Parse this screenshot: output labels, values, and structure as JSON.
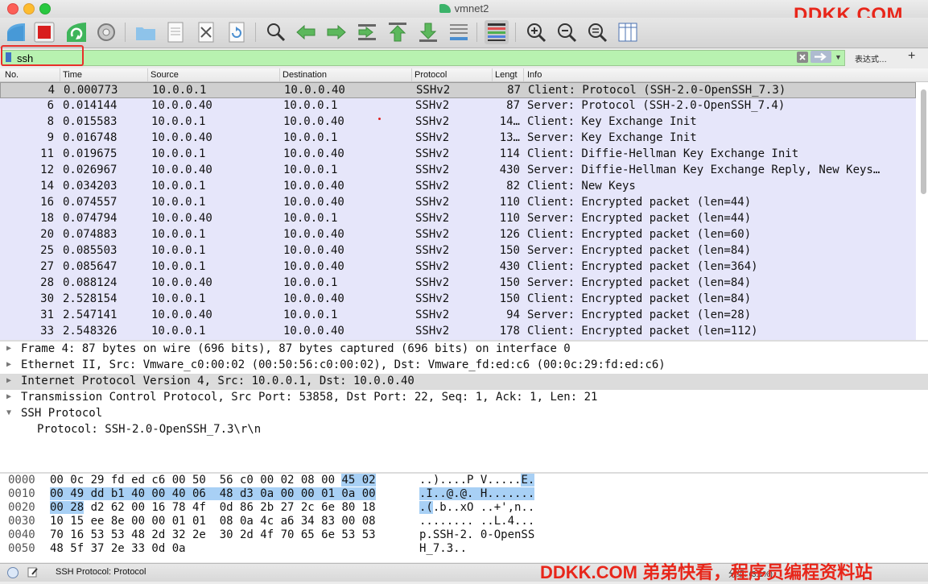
{
  "window": {
    "title": "vmnet2",
    "watermark_top": "DDKK.COM"
  },
  "toolbar": {
    "buttons": [
      "start-capture-icon",
      "stop-capture-icon",
      "restart-capture-icon",
      "capture-options-icon",
      "open-file-icon",
      "file-icon",
      "close-file-icon",
      "reload-icon",
      "find-packet-icon",
      "go-back-icon",
      "go-forward-icon",
      "go-to-packet-icon",
      "first-packet-icon",
      "last-packet-icon",
      "autoscroll-icon",
      "colorize-icon",
      "zoom-in-icon",
      "zoom-out-icon",
      "zoom-normal-icon",
      "resize-columns-icon"
    ]
  },
  "filter": {
    "value": "ssh",
    "expression_label": "表达式…",
    "plus_label": "+"
  },
  "columns": {
    "no": "No.",
    "time": "Time",
    "source": "Source",
    "destination": "Destination",
    "protocol": "Protocol",
    "length": "Lengt",
    "info": "Info"
  },
  "packets": [
    {
      "no": "4",
      "time": "0.000773",
      "src": "10.0.0.1",
      "dst": "10.0.0.40",
      "proto": "SSHv2",
      "len": "87",
      "info": "Client: Protocol (SSH-2.0-OpenSSH_7.3)"
    },
    {
      "no": "6",
      "time": "0.014144",
      "src": "10.0.0.40",
      "dst": "10.0.0.1",
      "proto": "SSHv2",
      "len": "87",
      "info": "Server: Protocol (SSH-2.0-OpenSSH_7.4)"
    },
    {
      "no": "8",
      "time": "0.015583",
      "src": "10.0.0.1",
      "dst": "10.0.0.40",
      "proto": "SSHv2",
      "len": "14…",
      "info": "Client: Key Exchange Init"
    },
    {
      "no": "9",
      "time": "0.016748",
      "src": "10.0.0.40",
      "dst": "10.0.0.1",
      "proto": "SSHv2",
      "len": "13…",
      "info": "Server: Key Exchange Init"
    },
    {
      "no": "11",
      "time": "0.019675",
      "src": "10.0.0.1",
      "dst": "10.0.0.40",
      "proto": "SSHv2",
      "len": "114",
      "info": "Client: Diffie-Hellman Key Exchange Init"
    },
    {
      "no": "12",
      "time": "0.026967",
      "src": "10.0.0.40",
      "dst": "10.0.0.1",
      "proto": "SSHv2",
      "len": "430",
      "info": "Server: Diffie-Hellman Key Exchange Reply, New Keys…"
    },
    {
      "no": "14",
      "time": "0.034203",
      "src": "10.0.0.1",
      "dst": "10.0.0.40",
      "proto": "SSHv2",
      "len": "82",
      "info": "Client: New Keys"
    },
    {
      "no": "16",
      "time": "0.074557",
      "src": "10.0.0.1",
      "dst": "10.0.0.40",
      "proto": "SSHv2",
      "len": "110",
      "info": "Client: Encrypted packet (len=44)"
    },
    {
      "no": "18",
      "time": "0.074794",
      "src": "10.0.0.40",
      "dst": "10.0.0.1",
      "proto": "SSHv2",
      "len": "110",
      "info": "Server: Encrypted packet (len=44)"
    },
    {
      "no": "20",
      "time": "0.074883",
      "src": "10.0.0.1",
      "dst": "10.0.0.40",
      "proto": "SSHv2",
      "len": "126",
      "info": "Client: Encrypted packet (len=60)"
    },
    {
      "no": "25",
      "time": "0.085503",
      "src": "10.0.0.1",
      "dst": "10.0.0.40",
      "proto": "SSHv2",
      "len": "150",
      "info": "Server: Encrypted packet (len=84)"
    },
    {
      "no": "27",
      "time": "0.085647",
      "src": "10.0.0.1",
      "dst": "10.0.0.40",
      "proto": "SSHv2",
      "len": "430",
      "info": "Client: Encrypted packet (len=364)"
    },
    {
      "no": "28",
      "time": "0.088124",
      "src": "10.0.0.40",
      "dst": "10.0.0.1",
      "proto": "SSHv2",
      "len": "150",
      "info": "Server: Encrypted packet (len=84)"
    },
    {
      "no": "30",
      "time": "2.528154",
      "src": "10.0.0.1",
      "dst": "10.0.0.40",
      "proto": "SSHv2",
      "len": "150",
      "info": "Client: Encrypted packet (len=84)"
    },
    {
      "no": "31",
      "time": "2.547141",
      "src": "10.0.0.40",
      "dst": "10.0.0.1",
      "proto": "SSHv2",
      "len": "94",
      "info": "Server: Encrypted packet (len=28)"
    },
    {
      "no": "33",
      "time": "2.548326",
      "src": "10.0.0.1",
      "dst": "10.0.0.40",
      "proto": "SSHv2",
      "len": "178",
      "info": "Client: Encrypted packet (len=112)"
    }
  ],
  "details": [
    {
      "text": "Frame 4: 87 bytes on wire (696 bits), 87 bytes captured (696 bits) on interface 0",
      "arrow": "▶",
      "child": false,
      "sel": false
    },
    {
      "text": "Ethernet II, Src: Vmware_c0:00:02 (00:50:56:c0:00:02), Dst: Vmware_fd:ed:c6 (00:0c:29:fd:ed:c6)",
      "arrow": "▶",
      "child": false,
      "sel": false
    },
    {
      "text": "Internet Protocol Version 4, Src: 10.0.0.1, Dst: 10.0.0.40",
      "arrow": "▶",
      "child": false,
      "sel": true
    },
    {
      "text": "Transmission Control Protocol, Src Port: 53858, Dst Port: 22, Seq: 1, Ack: 1, Len: 21",
      "arrow": "▶",
      "child": false,
      "sel": false
    },
    {
      "text": "SSH Protocol",
      "arrow": "▼",
      "child": false,
      "sel": false
    },
    {
      "text": "Protocol: SSH-2.0-OpenSSH_7.3\\r\\n",
      "arrow": "",
      "child": true,
      "sel": false
    }
  ],
  "bytes": [
    {
      "off": "0000",
      "hex": [
        {
          "t": "00 0c 29 fd ed c6 00 50  56 c0 00 02 08 00 ",
          "h": false
        },
        {
          "t": "45 02",
          "h": true
        }
      ],
      "asc": [
        {
          "t": "..)....P V.....",
          "h": false
        },
        {
          "t": "E.",
          "h": true
        }
      ]
    },
    {
      "off": "0010",
      "hex": [
        {
          "t": "00 49 dd b1 40 00 40 06  48 d3 0a 00 00 01 0a 00",
          "h": true
        }
      ],
      "asc": [
        {
          "t": ".I..@.@. H.......",
          "h": true
        }
      ]
    },
    {
      "off": "0020",
      "hex": [
        {
          "t": "00 28",
          "h": true
        },
        {
          "t": " d2 62 00 16 78 4f  0d 86 2b 27 2c 6e 80 18",
          "h": false
        }
      ],
      "asc": [
        {
          "t": ".(",
          "h": true
        },
        {
          "t": ".b..xO ..+',n..",
          "h": false
        }
      ]
    },
    {
      "off": "0030",
      "hex": [
        {
          "t": "10 15 ee 8e 00 00 01 01  08 0a 4c a6 34 83 00 08",
          "h": false
        }
      ],
      "asc": [
        {
          "t": "........ ..L.4...",
          "h": false
        }
      ]
    },
    {
      "off": "0040",
      "hex": [
        {
          "t": "70 16 53 53 48 2d 32 2e  30 2d 4f 70 65 6e 53 53",
          "h": false
        }
      ],
      "asc": [
        {
          "t": "p.SSH-2. 0-OpenSS",
          "h": false
        }
      ]
    },
    {
      "off": "0050",
      "hex": [
        {
          "t": "48 5f 37 2e 33 0d 0a",
          "h": false
        }
      ],
      "asc": [
        {
          "t": "H_7.3..",
          "h": false
        }
      ]
    }
  ],
  "status": {
    "text": "SSH Protocol: Protocol",
    "packets": "分组: (3.1%)",
    "watermark_bottom": "DDKK.COM 弟弟快看，程序员编程资料站"
  },
  "colors": {
    "filter_bg": "#b8f2b0",
    "row_bg": "#e6e6fa",
    "watermark": "#e8261a",
    "hex_highlight": "#a8d0f5"
  }
}
